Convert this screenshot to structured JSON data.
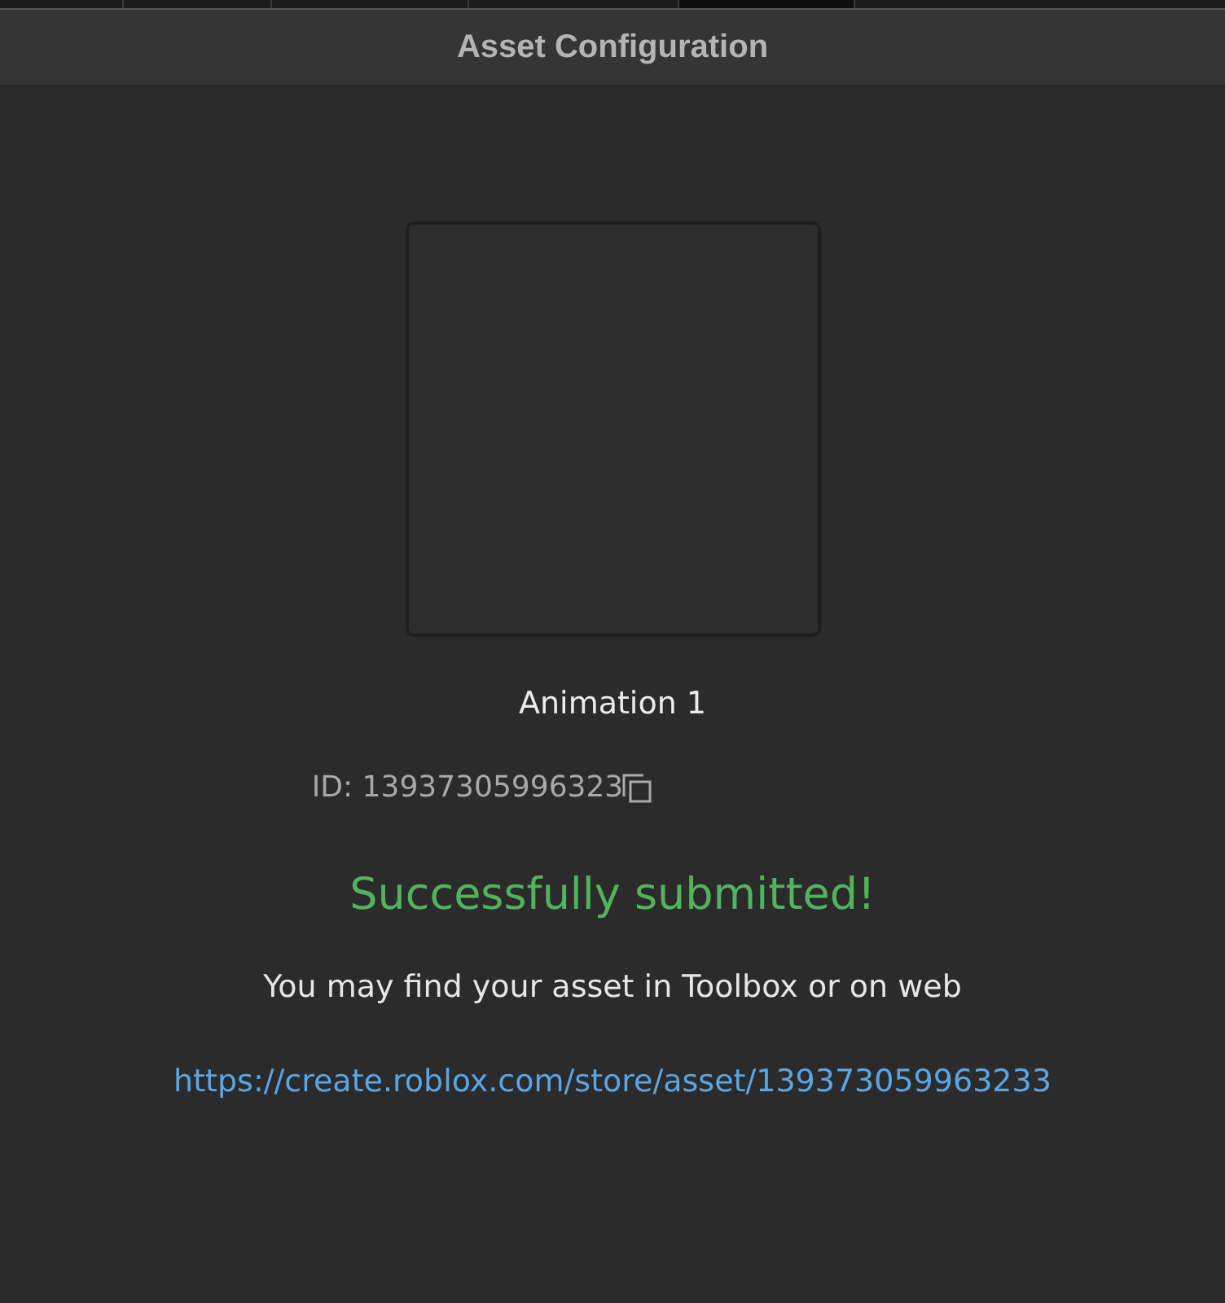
{
  "window": {
    "title": "Asset Configuration"
  },
  "asset": {
    "name": "Animation 1",
    "id_text": "ID: 13937305996323"
  },
  "status": {
    "message": "Successfully submitted!",
    "kind": "success"
  },
  "note": "You may find your asset in Toolbox or on web",
  "link": "https://create.roblox.com/store/asset/139373059963233"
}
